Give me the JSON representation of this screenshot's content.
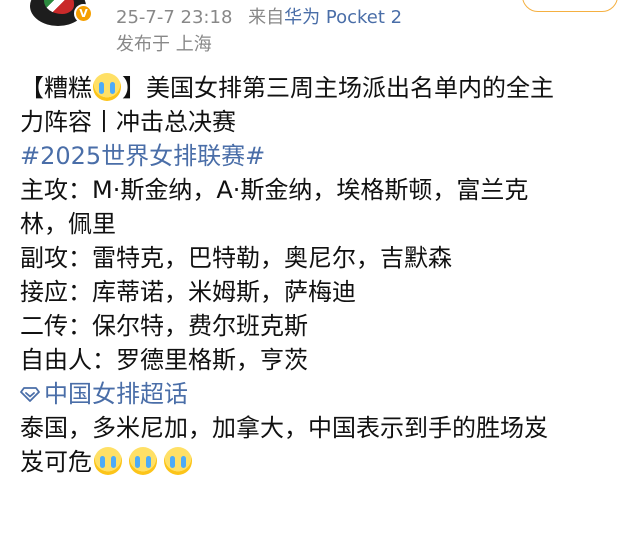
{
  "header": {
    "avatar_icon": "user-avatar-icon",
    "verified_icon": "verified-badge-icon",
    "timestamp": "25-7-7 23:18",
    "source_prefix": "来自",
    "source_device": "华为 Pocket 2",
    "location": "发布于 上海"
  },
  "post": {
    "line1_open": "【糟糕",
    "line1_close": "】美国女排第三周主场派出名单内的全主",
    "line2": "力阵容丨冲击总决赛",
    "hashtag": "#2025世界女排联赛#",
    "line4": "主攻：M·斯金纳，A·斯金纳，埃格斯顿，富兰克",
    "line5": "林，佩里",
    "line6": "副攻：雷特克，巴特勒，奥尼尔，吉默森",
    "line7": "接应：库蒂诺，米姆斯，萨梅迪",
    "line8": "二传：保尔特，费尔班克斯",
    "line9": "自由人：罗德里格斯，亨茨",
    "topic_icon": "super-topic-diamond-icon",
    "topic": "中国女排超话",
    "line11": "泰国，多米尼加，加拿大，中国表示到手的胜场岌",
    "line12": "岌可危",
    "emoji_name": "crying-face-emoji"
  },
  "colors": {
    "link": "#4a6ea8",
    "meta": "#888888",
    "follow_border": "#f5b041",
    "verified": "#f59f00"
  }
}
